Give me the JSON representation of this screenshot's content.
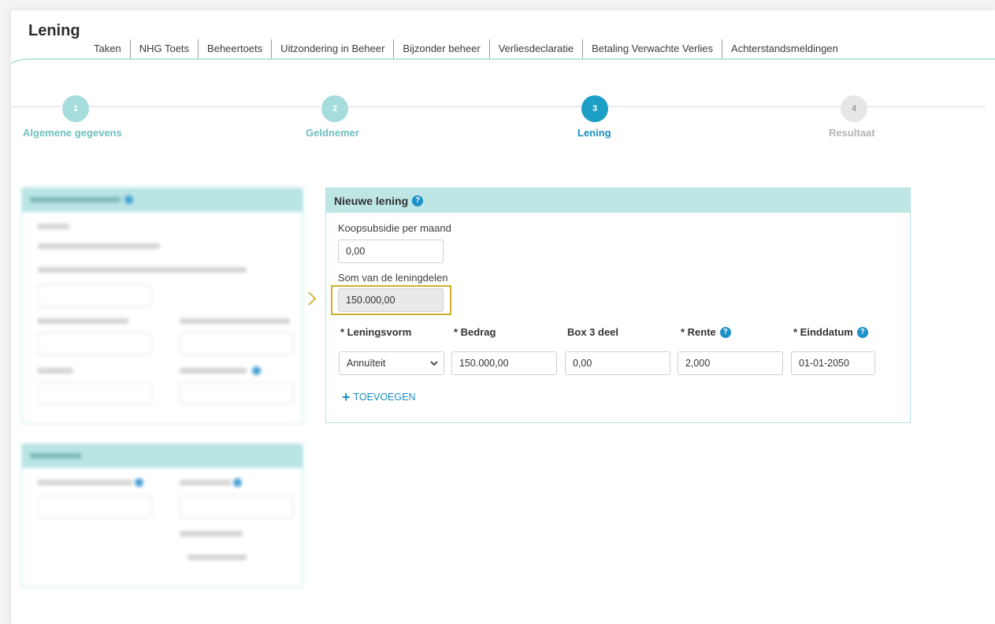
{
  "header": {
    "title": "Lening",
    "tabs": [
      "Taken",
      "NHG Toets",
      "Beheertoets",
      "Uitzondering in Beheer",
      "Bijzonder beheer",
      "Verliesdeclaratie",
      "Betaling Verwachte Verlies",
      "Achterstandsmeldingen"
    ]
  },
  "stepper": {
    "steps": [
      {
        "number": "1",
        "label": "Algemene gegevens",
        "state": "done"
      },
      {
        "number": "2",
        "label": "Geldnemer",
        "state": "done"
      },
      {
        "number": "3",
        "label": "Lening",
        "state": "active"
      },
      {
        "number": "4",
        "label": "Resultaat",
        "state": "pending"
      }
    ]
  },
  "new_loan": {
    "title": "Nieuwe lening",
    "help_icon": "question-circle-icon",
    "koopsubsidie_label": "Koopsubsidie per maand",
    "koopsubsidie_value": "0,00",
    "som_label": "Som van de leningdelen",
    "som_value": "150.000,00",
    "columns": {
      "leningsvorm": "* Leningsvorm",
      "bedrag": "* Bedrag",
      "box3": "Box 3 deel",
      "rente": "* Rente",
      "einddatum": "* Einddatum"
    },
    "row": {
      "leningsvorm": "Annuïteit",
      "bedrag": "150.000,00",
      "box3": "0,00",
      "rente": "2,000",
      "einddatum": "01-01-2050"
    },
    "add_label": "TOEVOEGEN"
  },
  "colors": {
    "accent": "#1a90c9",
    "step_done": "#a6dcdc",
    "step_active": "#1c9fc4",
    "step_pending": "#e6e6e6",
    "panel_header": "#bde6e5",
    "highlight": "#cfb02c"
  }
}
